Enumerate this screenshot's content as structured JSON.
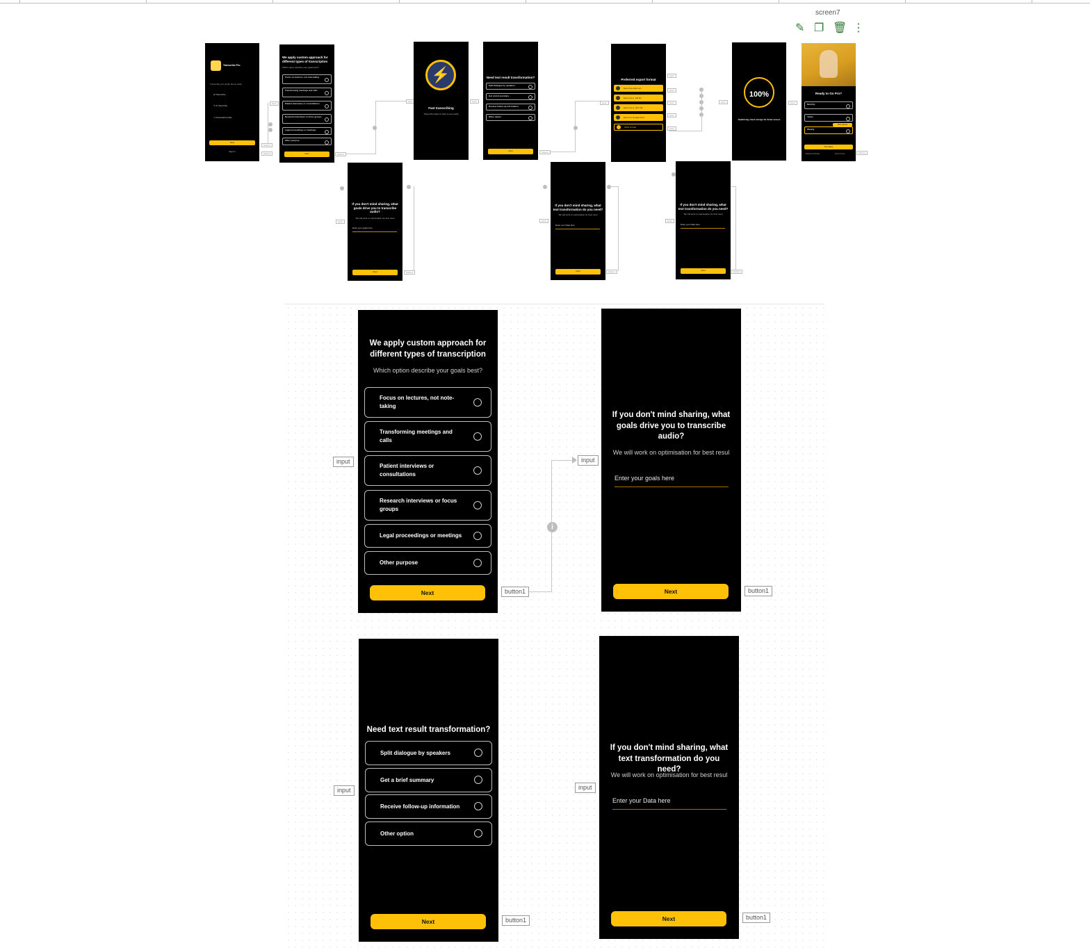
{
  "canvas": {
    "selected_screen_name": "screen7",
    "toolbar": {
      "edit": "pencil-icon",
      "duplicate": "copy-icon",
      "delete": "trash-icon",
      "more": "more-vertical-icon"
    }
  },
  "connectors": {
    "input": "input",
    "button": "button1"
  },
  "mini": {
    "app_name": "Transcribe Pro",
    "intro_text": "Transcribe your audio fast & easily",
    "welcome_items": [
      "Transcribe",
      "AI transcribe",
      "Download results"
    ],
    "next": "Next",
    "sign_in": "Sign in",
    "goals_title": "We apply custom approach for different types of transcription",
    "goals_sub": "Which option describe your goals best?",
    "goals_options": [
      "Focus on lectures, not note-taking",
      "Transforming meetings and calls",
      "Patient interviews or consultations",
      "Research interviews or focus groups",
      "Legal proceedings or meetings",
      "Other purpose"
    ],
    "fast_title": "Fast transcribing",
    "fast_sub": "Transcribe audio & video to text easily",
    "transform_title": "Need text result transformation?",
    "transform_options": [
      "Split dialogue by speakers",
      "Get a brief summary",
      "Receive follow-up information",
      "Other option"
    ],
    "export_title": "Preferred export format",
    "export_options": [
      "Export as plain text",
      "Export as a .pdf file",
      "Export as a .docx file",
      "Export to Google Docs",
      "Other format"
    ],
    "progress_value": "100%",
    "progress_sub": "Optimising cloud storage for faster access",
    "pro_title": "Ready to Go Pro?",
    "pro_plans": [
      "Monthly",
      "Yearly",
      "Weekly"
    ],
    "pro_badge": "Most popular",
    "pro_cta": "Purchase",
    "pro_footer": [
      "Restore Purchase",
      "Terms of use"
    ],
    "q_goals": "If you don't mind sharing, what goals drive you to transcribe audio?",
    "q_transform": "If you don't mind sharing, what text transformation do you need?",
    "q_sub": "We will work on optimisation for best resul",
    "goals_placeholder": "Enter your goals here",
    "data_placeholder": "Enter your Data here"
  },
  "detail": {
    "goals_screen": {
      "title": "We apply custom approach for different types of transcription",
      "subtitle": "Which option describe your goals best?",
      "options": [
        "Focus on lectures, not note-taking",
        "Transforming meetings and calls",
        "Patient interviews or consultations",
        "Research interviews or focus groups",
        "Legal proceedings or meetings",
        "Other purpose"
      ],
      "next": "Next"
    },
    "goals_question_screen": {
      "title": "If you don't mind sharing, what goals drive you to transcribe audio?",
      "subtitle": "We will work on optimisation for best resul",
      "placeholder": "Enter your goals here",
      "next": "Next"
    },
    "transform_screen": {
      "title": "Need text result transformation?",
      "options": [
        "Split dialogue by speakers",
        "Get a brief summary",
        "Receive follow-up information",
        "Other option"
      ],
      "next": "Next"
    },
    "transform_question_screen": {
      "title": "If you don't mind sharing, what text transformation do you need?",
      "subtitle": "We will work on optimisation for best resul",
      "placeholder": "Enter your Data here",
      "next": "Next"
    }
  }
}
